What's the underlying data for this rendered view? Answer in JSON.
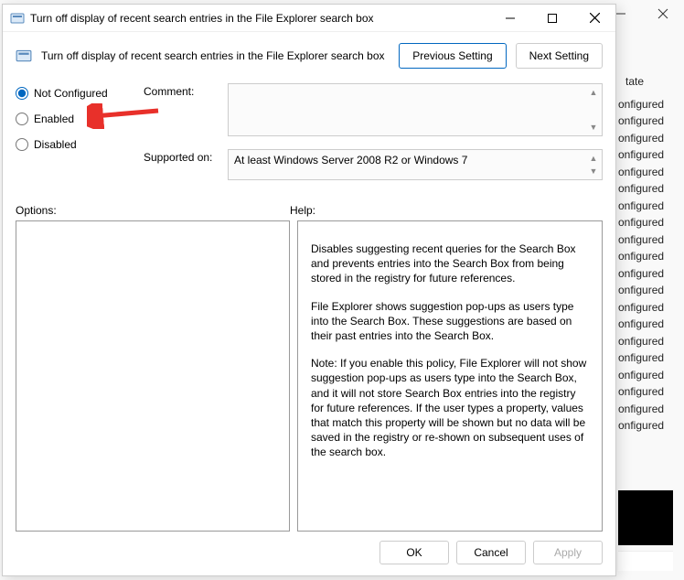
{
  "bg": {
    "state_header": "tate",
    "items": [
      "onfigured",
      "onfigured",
      "onfigured",
      "onfigured",
      "onfigured",
      "onfigured",
      "onfigured",
      "onfigured",
      "onfigured",
      "onfigured",
      "onfigured",
      "onfigured",
      "onfigured",
      "onfigured",
      "onfigured",
      "onfigured",
      "onfigured",
      "onfigured",
      "onfigured",
      "onfigured"
    ]
  },
  "dialog": {
    "title": "Turn off display of recent search entries in the File Explorer search box",
    "header_title": "Turn off display of recent search entries in the File Explorer search box",
    "nav": {
      "previous": "Previous Setting",
      "next": "Next Setting"
    },
    "radios": {
      "not_configured": "Not Configured",
      "enabled": "Enabled",
      "disabled": "Disabled",
      "selected": "not_configured"
    },
    "comment_label": "Comment:",
    "comment_value": "",
    "supported_label": "Supported on:",
    "supported_value": "At least Windows Server 2008 R2 or Windows 7",
    "options_label": "Options:",
    "help_label": "Help:",
    "help_paragraphs": [
      "Disables suggesting recent queries for the Search Box and prevents entries into the Search Box from being stored in the registry for future references.",
      "File Explorer shows suggestion pop-ups as users type into the Search Box.  These suggestions are based on their past entries into the Search Box.",
      "Note: If you enable this policy, File Explorer will not show suggestion pop-ups as users type into the Search Box, and it will not store Search Box entries into the registry for future references.  If the user types a property, values that match this property will be shown but no data will be saved in the registry or re-shown on subsequent uses of the search box."
    ],
    "buttons": {
      "ok": "OK",
      "cancel": "Cancel",
      "apply": "Apply"
    }
  }
}
